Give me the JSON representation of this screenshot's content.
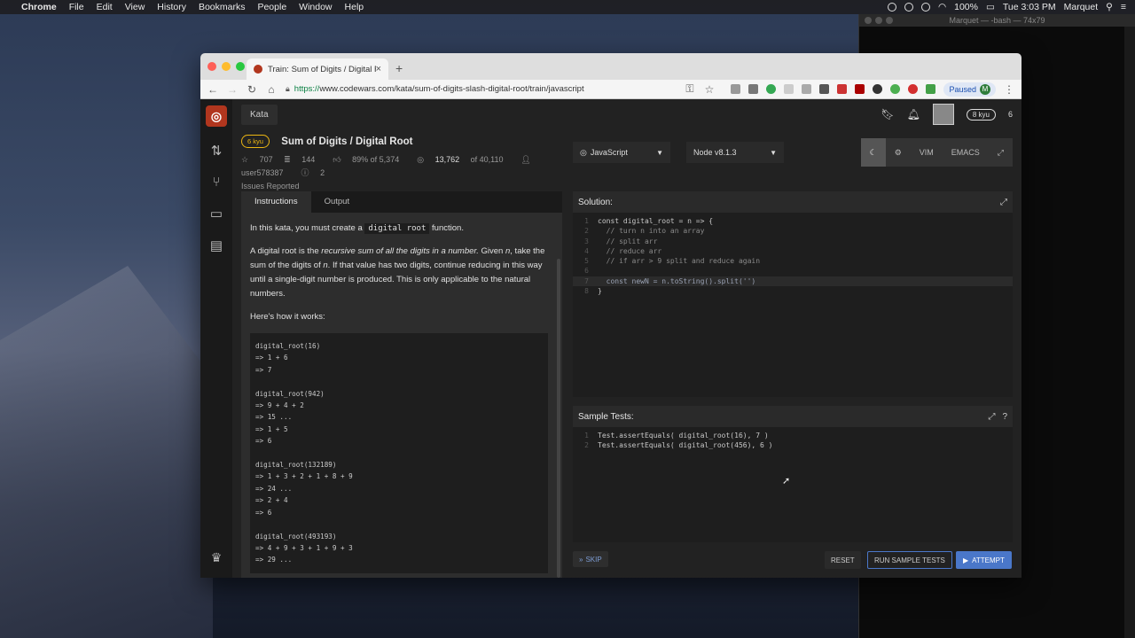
{
  "menubar": {
    "app": "Chrome",
    "menus": [
      "File",
      "Edit",
      "View",
      "History",
      "Bookmarks",
      "People",
      "Window",
      "Help"
    ],
    "battery": "100%",
    "clock": "Tue 3:03 PM",
    "user": "Marquet"
  },
  "terminal": {
    "title": "Marquet — -bash — 74x79"
  },
  "browser": {
    "tab_title": "Train: Sum of Digits / Digital Ro",
    "tab_close": "×",
    "new_tab": "+",
    "url_scheme": "https://",
    "url_rest": "www.codewars.com/kata/sum-of-digits-slash-digital-root/train/javascript",
    "paused_label": "Paused",
    "profile_initial": "M"
  },
  "codewars": {
    "nav_kata": "Kata",
    "rank_pill": "8 kyu",
    "honor": "6",
    "kata": {
      "kyu": "6 kyu",
      "title": "Sum of Digits / Digital Root",
      "stars": "707",
      "collections": "144",
      "satisfaction": "89% of 5,374",
      "completed": "13,762",
      "completed_of": "of 40,110",
      "author": "user578387",
      "issues_count": "2",
      "issues_label": "Issues Reported"
    },
    "instruction_tabs": [
      "Instructions",
      "Output"
    ],
    "instructions": {
      "p1_before": "In this kata, you must create a ",
      "p1_code": "digital root",
      "p1_after": " function.",
      "p2_before": "A digital root is the ",
      "p2_em": "recursive sum of all the digits in a number.",
      "p2_mid1": " Given ",
      "p2_n1": "n",
      "p2_mid2": ", take the sum of the digits of ",
      "p2_n2": "n",
      "p2_after": ". If that value has two digits, continue reducing in this way until a single-digit number is produced. This is only applicable to the natural numbers.",
      "p3": "Here's how it works:",
      "examples": [
        "digital_root(16)\n=> 1 + 6\n=> 7",
        "digital_root(942)\n=> 9 + 4 + 2\n=> 15 ...\n=> 1 + 5\n=> 6",
        "digital_root(132189)\n=> 1 + 3 + 2 + 1 + 8 + 9\n=> 24 ...\n=> 2 + 4\n=> 6",
        "digital_root(493193)\n=> 4 + 9 + 3 + 1 + 9 + 3\n=> 29 ..."
      ]
    },
    "language": "JavaScript",
    "runtime": "Node v8.1.3",
    "modes": [
      "VIM",
      "EMACS"
    ],
    "solution_label": "Solution:",
    "solution_lines": [
      {
        "n": "1",
        "text": "const digital_root = n => {"
      },
      {
        "n": "2",
        "text": "  // turn n into an array"
      },
      {
        "n": "3",
        "text": "  // split arr"
      },
      {
        "n": "4",
        "text": "  // reduce arr"
      },
      {
        "n": "5",
        "text": "  // if arr > 9 split and reduce again"
      },
      {
        "n": "6",
        "text": ""
      },
      {
        "n": "7",
        "text": "  const newN = n.toString().split('')"
      },
      {
        "n": "8",
        "text": "}"
      }
    ],
    "tests_label": "Sample Tests:",
    "test_lines": [
      {
        "n": "1",
        "text": "Test.assertEquals( digital_root(16), 7 )"
      },
      {
        "n": "2",
        "text": "Test.assertEquals( digital_root(456), 6 )"
      }
    ],
    "buttons": {
      "skip": "SKIP",
      "reset": "RESET",
      "run": "RUN SAMPLE TESTS",
      "attempt": "ATTEMPT"
    }
  },
  "colors": {
    "kyu_yellow": "#ecb613",
    "brand_red": "#b1361e",
    "attempt_blue": "#4a77c9"
  }
}
